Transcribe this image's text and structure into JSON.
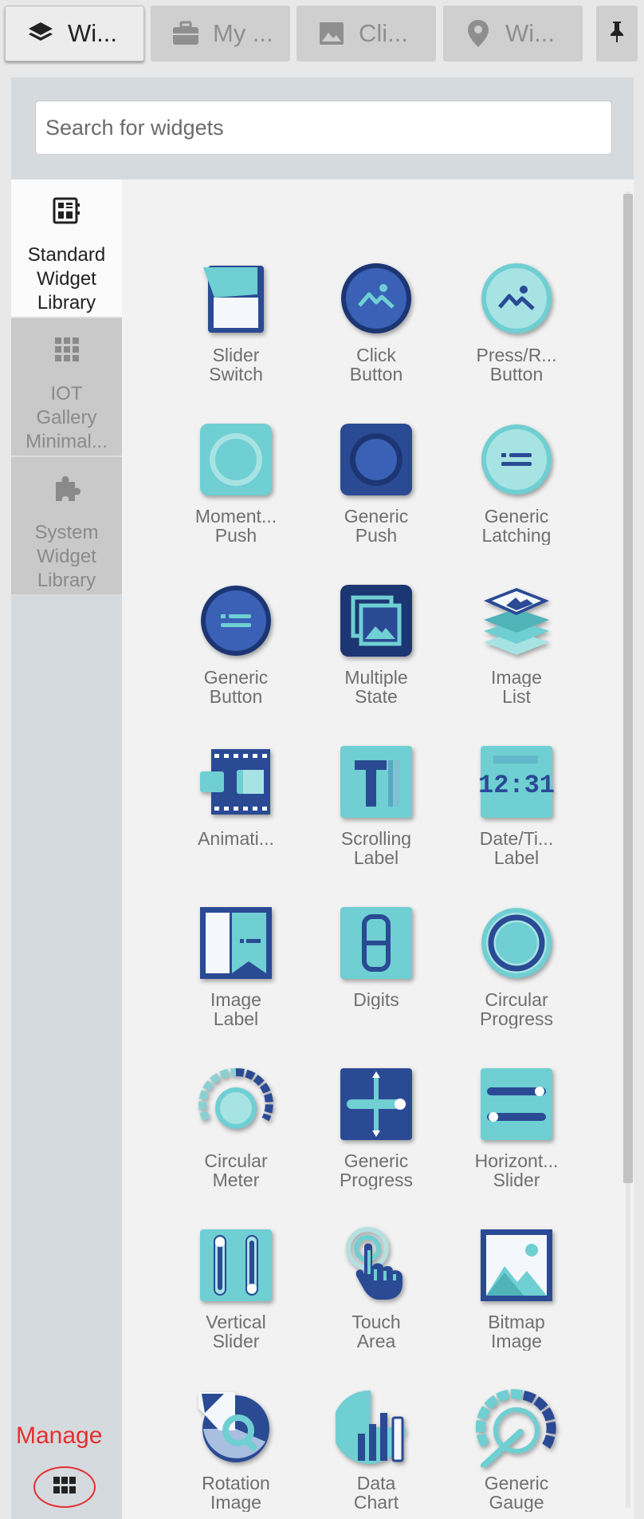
{
  "top_tabs": [
    {
      "label": "Wi...",
      "icon": "layers-icon",
      "active": true
    },
    {
      "label": "My ...",
      "icon": "briefcase-icon",
      "active": false
    },
    {
      "label": "Cli...",
      "icon": "image-icon",
      "active": false
    },
    {
      "label": "Wi...",
      "icon": "location-pin-icon",
      "active": false
    }
  ],
  "pin_icon": "pin-icon",
  "search": {
    "placeholder": "Search for widgets",
    "value": ""
  },
  "side_tabs": [
    {
      "lines": [
        "Standard",
        "Widget",
        "Library"
      ],
      "icon": "widget-library-icon",
      "active": true
    },
    {
      "lines": [
        "IOT",
        "Gallery",
        "Minimal..."
      ],
      "icon": "grid-icon",
      "active": false
    },
    {
      "lines": [
        "System",
        "Widget",
        "Library"
      ],
      "icon": "puzzle-icon",
      "active": false
    }
  ],
  "widgets": [
    {
      "lines": [
        "Slider",
        "Switch"
      ],
      "icon": "slider-switch-icon"
    },
    {
      "lines": [
        "Click",
        "Button"
      ],
      "icon": "click-button-icon"
    },
    {
      "lines": [
        "Press/R...",
        "Button"
      ],
      "icon": "press-release-button-icon"
    },
    {
      "lines": [
        "Moment...",
        "Push"
      ],
      "icon": "momentary-push-icon"
    },
    {
      "lines": [
        "Generic",
        "Push"
      ],
      "icon": "generic-push-icon"
    },
    {
      "lines": [
        "Generic",
        "Latching"
      ],
      "icon": "generic-latching-icon"
    },
    {
      "lines": [
        "Generic",
        "Button"
      ],
      "icon": "generic-button-icon"
    },
    {
      "lines": [
        "Multiple",
        "State"
      ],
      "icon": "multiple-state-icon"
    },
    {
      "lines": [
        "Image",
        "List"
      ],
      "icon": "image-list-icon"
    },
    {
      "lines": [
        "Animati..."
      ],
      "icon": "animation-icon"
    },
    {
      "lines": [
        "Scrolling",
        "Label"
      ],
      "icon": "scrolling-label-icon"
    },
    {
      "lines": [
        "Date/Ti...",
        "Label"
      ],
      "icon": "date-time-label-icon"
    },
    {
      "lines": [
        "Image",
        "Label"
      ],
      "icon": "image-label-icon"
    },
    {
      "lines": [
        "Digits"
      ],
      "icon": "digits-icon"
    },
    {
      "lines": [
        "Circular",
        "Progress"
      ],
      "icon": "circular-progress-icon"
    },
    {
      "lines": [
        "Circular",
        "Meter"
      ],
      "icon": "circular-meter-icon"
    },
    {
      "lines": [
        "Generic",
        "Progress"
      ],
      "icon": "generic-progress-icon"
    },
    {
      "lines": [
        "Horizont...",
        "Slider"
      ],
      "icon": "horizontal-slider-icon"
    },
    {
      "lines": [
        "Vertical",
        "Slider"
      ],
      "icon": "vertical-slider-icon"
    },
    {
      "lines": [
        "Touch",
        "Area"
      ],
      "icon": "touch-area-icon"
    },
    {
      "lines": [
        "Bitmap",
        "Image"
      ],
      "icon": "bitmap-image-icon"
    },
    {
      "lines": [
        "Rotation",
        "Image"
      ],
      "icon": "rotation-image-icon"
    },
    {
      "lines": [
        "Data",
        "Chart"
      ],
      "icon": "data-chart-icon"
    },
    {
      "lines": [
        "Generic",
        "Gauge"
      ],
      "icon": "generic-gauge-icon"
    }
  ],
  "manage": {
    "label": "Manage",
    "icon": "grid-icon"
  },
  "colors": {
    "dark_blue": "#2a4a94",
    "teal": "#6fcfd2",
    "annotation_red": "#e53030"
  }
}
